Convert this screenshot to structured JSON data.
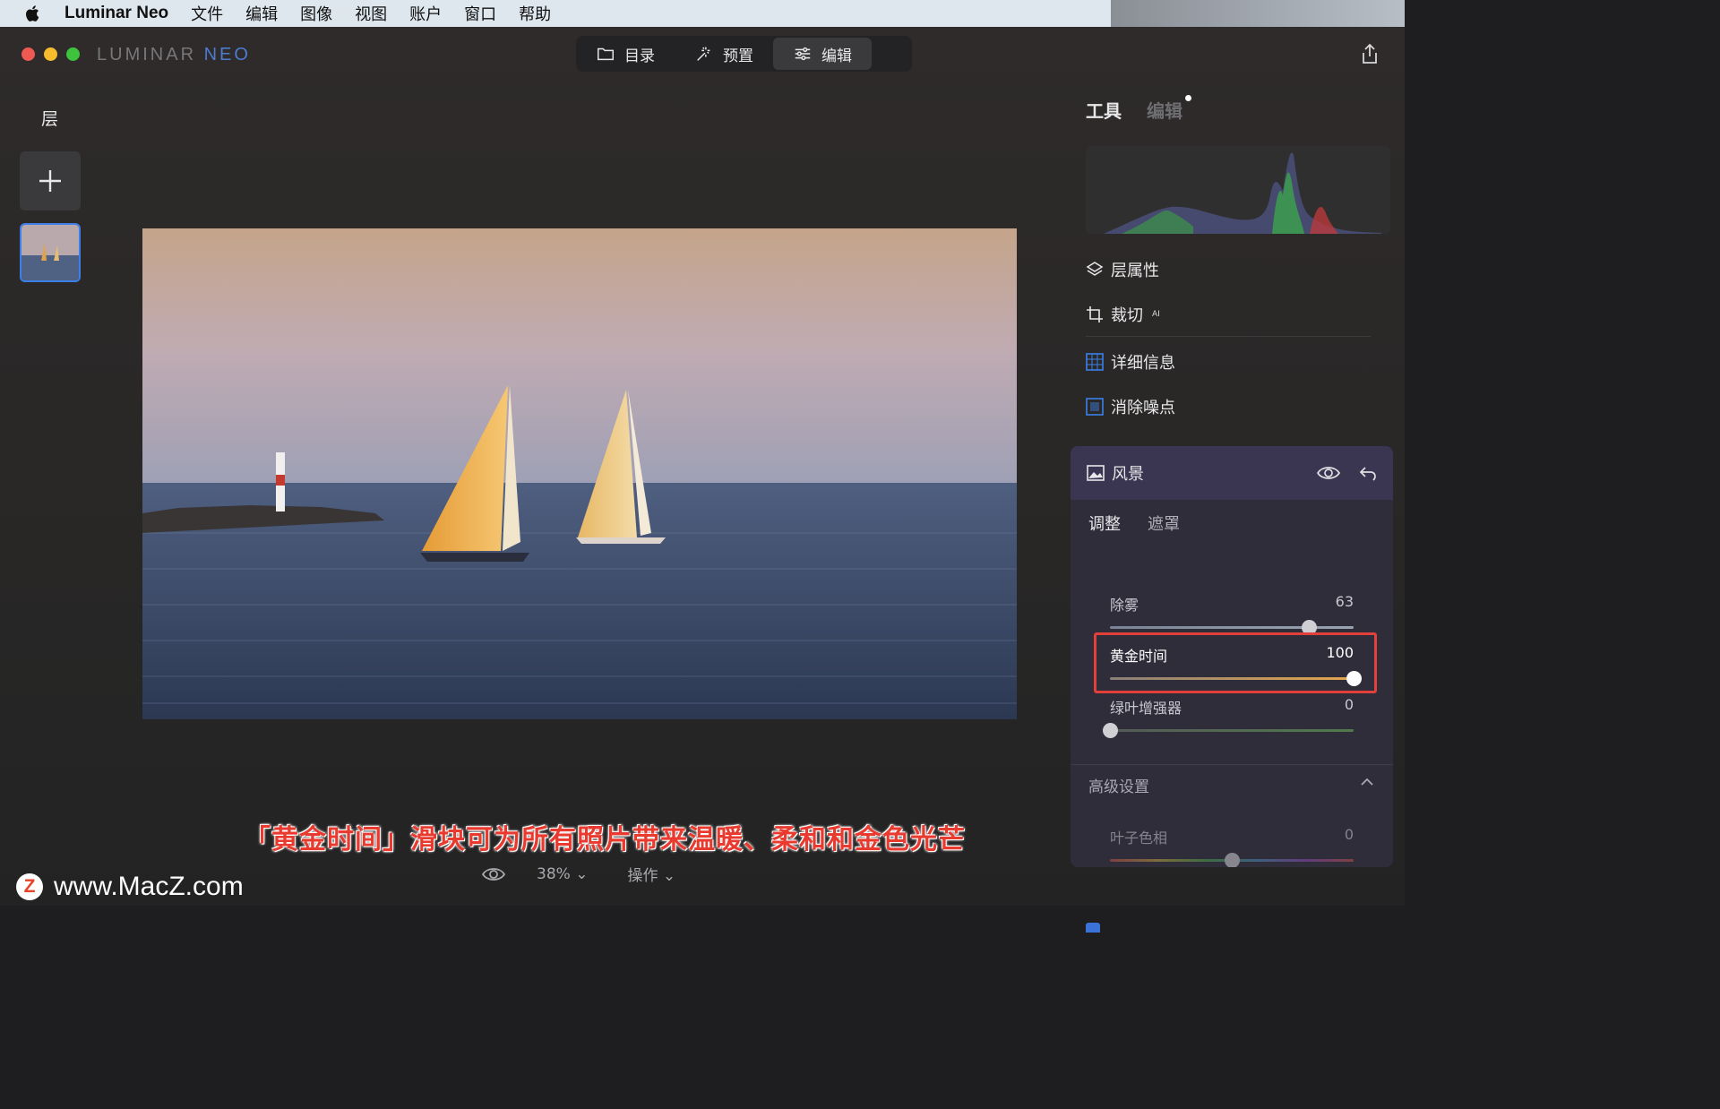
{
  "menubar": {
    "apple_icon": "apple-logo-icon",
    "items": [
      "Luminar Neo",
      "文件",
      "编辑",
      "图像",
      "视图",
      "账户",
      "窗口",
      "帮助"
    ]
  },
  "app": {
    "logo_left": "LUMINAR",
    "logo_right": "NEO",
    "modes": [
      {
        "label": "目录",
        "icon": "folder-icon"
      },
      {
        "label": "预置",
        "icon": "sparkle-wand-icon"
      },
      {
        "label": "编辑",
        "icon": "sliders-icon"
      }
    ],
    "active_mode": "编辑"
  },
  "layers": {
    "title": "层"
  },
  "viewbar": {
    "zoom": "38%",
    "actions": "操作"
  },
  "caption": "「黄金时间」滑块可为所有照片带来温暖、柔和和金色光芒",
  "watermark": {
    "badge": "Z",
    "text": "www.MacZ.com"
  },
  "right": {
    "tabs": [
      "工具",
      "编辑"
    ],
    "tools": [
      {
        "label": "层属性",
        "icon": "layers-icon",
        "ai": ""
      },
      {
        "label": "裁切",
        "icon": "crop-icon",
        "ai": "AI"
      },
      {
        "label": "详细信息",
        "icon": "details-grid-icon",
        "ai": ""
      },
      {
        "label": "消除噪点",
        "icon": "denoise-icon",
        "ai": ""
      }
    ]
  },
  "landscape": {
    "title": "风景",
    "subtabs": [
      "调整",
      "遮罩"
    ],
    "sliders": [
      {
        "label": "除雾",
        "value": 63,
        "min": -100,
        "max": 100
      },
      {
        "label": "黄金时间",
        "value": 100,
        "min": 0,
        "max": 100
      },
      {
        "label": "绿叶增强器",
        "value": 0,
        "min": 0,
        "max": 100
      }
    ],
    "advanced_title": "高级设置",
    "advanced_sliders": [
      {
        "label": "叶子色相",
        "value": 0,
        "min": -100,
        "max": 100
      }
    ]
  },
  "colors": {
    "accent_blue": "#3c7fe8",
    "highlight_red": "#e2403a",
    "caption_red": "#e83a2e"
  }
}
